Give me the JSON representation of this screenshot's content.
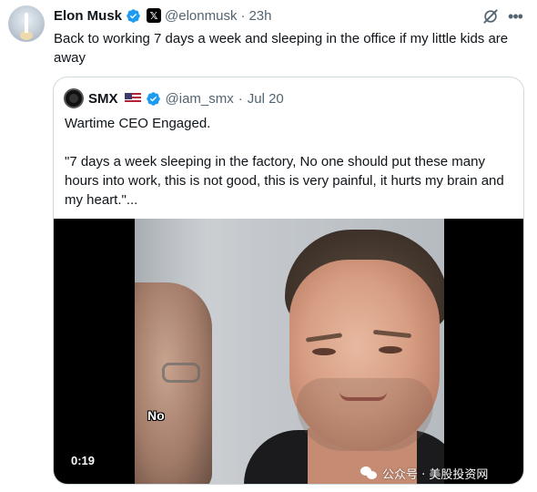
{
  "tweet": {
    "author_name": "Elon Musk",
    "handle": "@elonmusk",
    "separator": "·",
    "time": "23h",
    "affiliate_badge": "𝕏",
    "text": "Back to working 7 days a week and sleeping in the office if my little kids are away",
    "icons": {
      "verified": "verified-badge-icon",
      "grok": "grok-icon",
      "more": "more-icon"
    }
  },
  "quote": {
    "author_name": "SMX",
    "flag": "🇺🇸",
    "handle": "@iam_smx",
    "separator": "·",
    "time": "Jul 20",
    "text": "Wartime CEO Engaged.\n\n\"7 days a week sleeping in the factory, No one should put these many hours into work, this is not good, this is very painful, it hurts my brain and my heart.\"..."
  },
  "video": {
    "caption": "No",
    "duration": "0:19"
  },
  "watermark": {
    "text": "公众号 · 美股投资网"
  },
  "colors": {
    "text_primary": "#0f1419",
    "text_secondary": "#536471",
    "verified_blue": "#1d9bf0",
    "border": "#cfd9de"
  }
}
